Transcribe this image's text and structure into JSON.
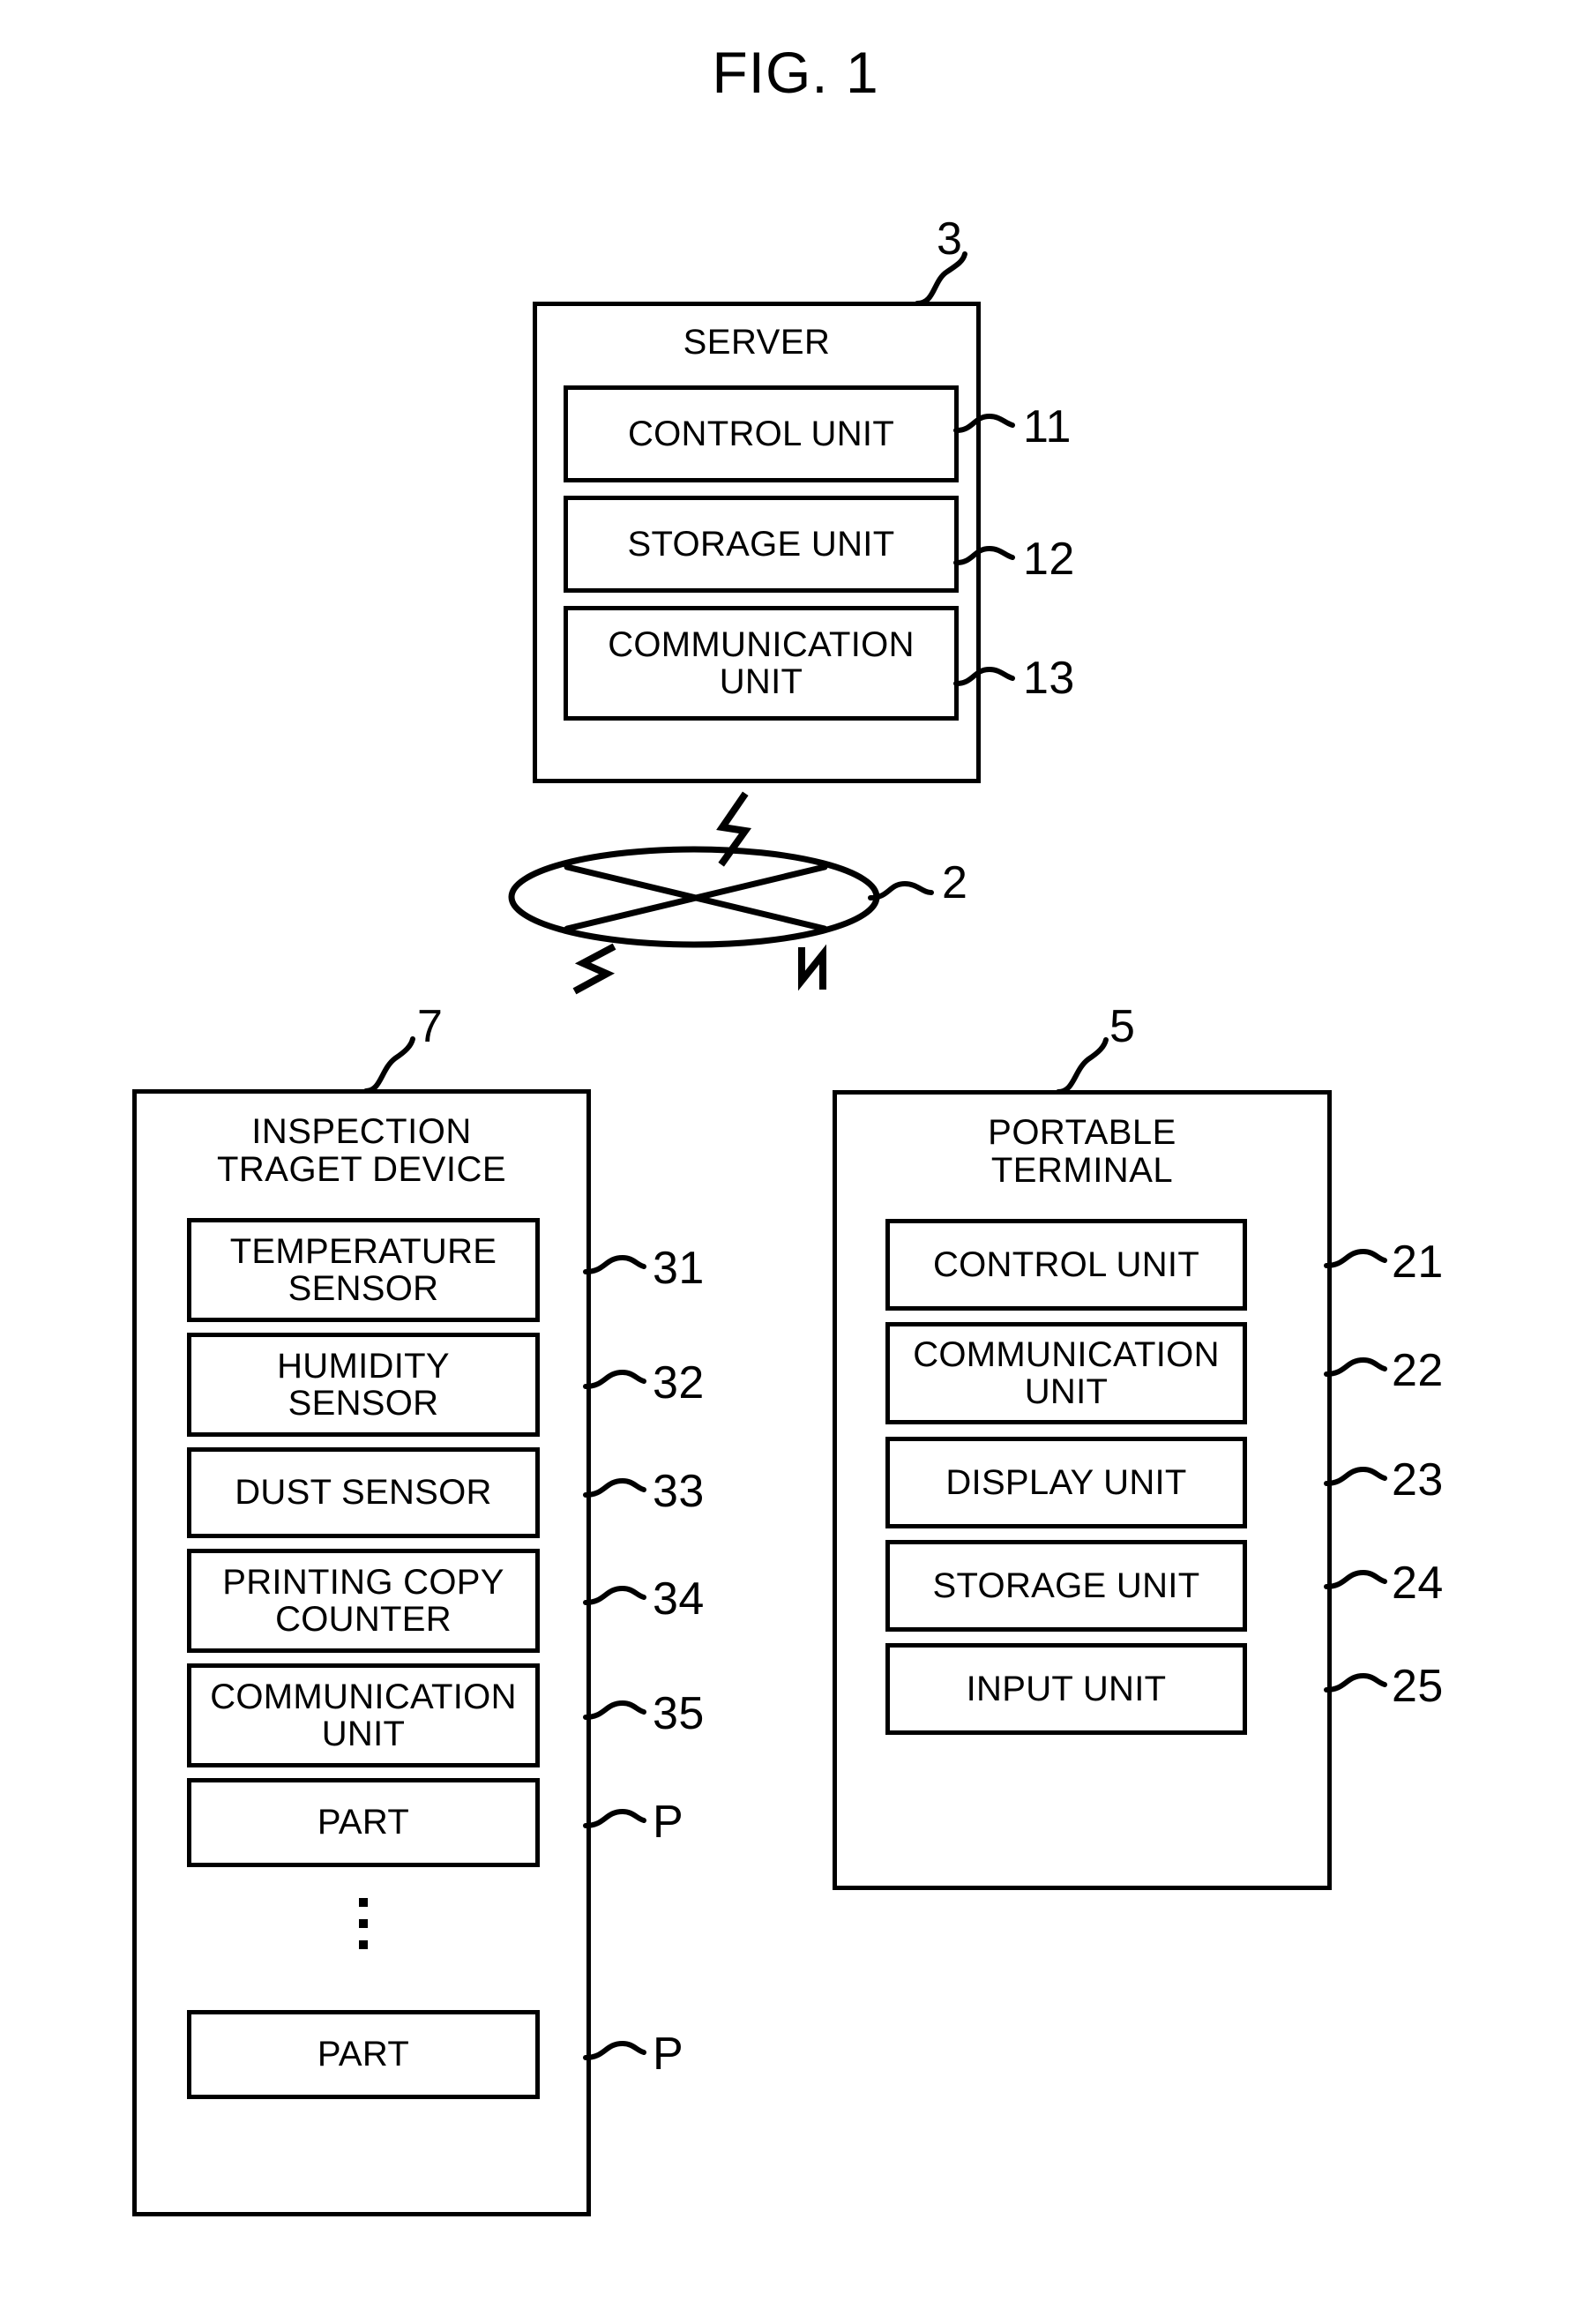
{
  "figure": {
    "title": "FIG. 1"
  },
  "server": {
    "title": "SERVER",
    "ref": "3",
    "units": [
      {
        "label": "CONTROL UNIT",
        "ref": "11"
      },
      {
        "label": "STORAGE UNIT",
        "ref": "12"
      },
      {
        "label_line1": "COMMUNICATION",
        "label_line2": "UNIT",
        "ref": "13"
      }
    ]
  },
  "network": {
    "ref": "2",
    "icon": "network-cloud-ellipse"
  },
  "inspection_device": {
    "title_line1": "INSPECTION",
    "title_line2": "TRAGET DEVICE",
    "ref": "7",
    "units": [
      {
        "label_line1": "TEMPERATURE",
        "label_line2": "SENSOR",
        "ref": "31"
      },
      {
        "label_line1": "HUMIDITY",
        "label_line2": "SENSOR",
        "ref": "32"
      },
      {
        "label_line1": "DUST SENSOR",
        "label_line2": "",
        "ref": "33"
      },
      {
        "label_line1": "PRINTING COPY",
        "label_line2": "COUNTER",
        "ref": "34"
      },
      {
        "label_line1": "COMMUNICATION",
        "label_line2": "UNIT",
        "ref": "35"
      },
      {
        "label_line1": "PART",
        "label_line2": "",
        "ref": "P"
      },
      {
        "label_line1": "PART",
        "label_line2": "",
        "ref": "P"
      }
    ],
    "ellipsis": "vertical-ellipsis"
  },
  "portable_terminal": {
    "title_line1": "PORTABLE",
    "title_line2": "TERMINAL",
    "ref": "5",
    "units": [
      {
        "label_line1": "CONTROL UNIT",
        "label_line2": "",
        "ref": "21"
      },
      {
        "label_line1": "COMMUNICATION",
        "label_line2": "UNIT",
        "ref": "22"
      },
      {
        "label_line1": "DISPLAY UNIT",
        "label_line2": "",
        "ref": "23"
      },
      {
        "label_line1": "STORAGE UNIT",
        "label_line2": "",
        "ref": "24"
      },
      {
        "label_line1": "INPUT UNIT",
        "label_line2": "",
        "ref": "25"
      }
    ]
  },
  "colors": {
    "line": "#000000",
    "background": "#ffffff"
  }
}
